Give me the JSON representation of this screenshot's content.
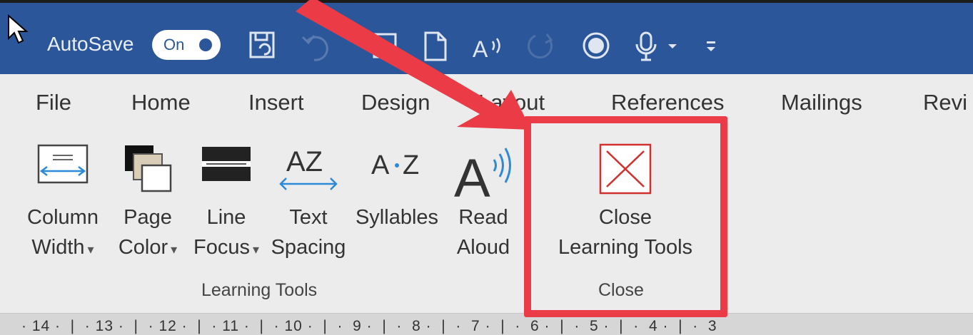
{
  "titlebar": {
    "autosave_label": "AutoSave",
    "autosave_toggle": "On",
    "color": "#2b579a"
  },
  "qat_icons": [
    "save-icon",
    "undo-icon",
    "print-preview-icon",
    "new-document-icon",
    "read-aloud-icon",
    "redo-icon",
    "record-icon",
    "dictate-microphone-icon",
    "customize-toolbar-icon"
  ],
  "tabs": [
    "File",
    "Home",
    "Insert",
    "Design",
    "Layout",
    "References",
    "Mailings",
    "Revi"
  ],
  "ribbon": {
    "buttons": [
      {
        "line1": "Column",
        "line2": "Width",
        "icon": "column-width-icon",
        "dropdown": true
      },
      {
        "line1": "Page",
        "line2": "Color",
        "icon": "page-color-icon",
        "dropdown": true
      },
      {
        "line1": "Line",
        "line2": "Focus",
        "icon": "line-focus-icon",
        "dropdown": true
      },
      {
        "line1": "Text",
        "line2": "Spacing",
        "icon": "text-spacing-icon",
        "dropdown": false
      },
      {
        "line1": "Syllables",
        "line2": "",
        "icon": "syllables-icon",
        "dropdown": false
      },
      {
        "line1": "Read",
        "line2": "Aloud",
        "icon": "read-aloud-icon",
        "dropdown": false
      }
    ],
    "close_button": {
      "line1": "Close",
      "line2": "Learning Tools",
      "icon": "close-icon"
    },
    "group_learning_tools": "Learning Tools",
    "group_close": "Close",
    "caret": "▾"
  },
  "ruler": {
    "text": "· 14 ·  |  · 13 ·  |  · 12 ·  |  · 11 ·  |  · 10 ·  |  ·  9 ·  |  ·  8 ·  |  ·  7 ·  |  ·  6 ·  |  ·  5 ·  |  ·  4 ·  |  ·  3"
  },
  "annotation_color": "#ea3b46"
}
